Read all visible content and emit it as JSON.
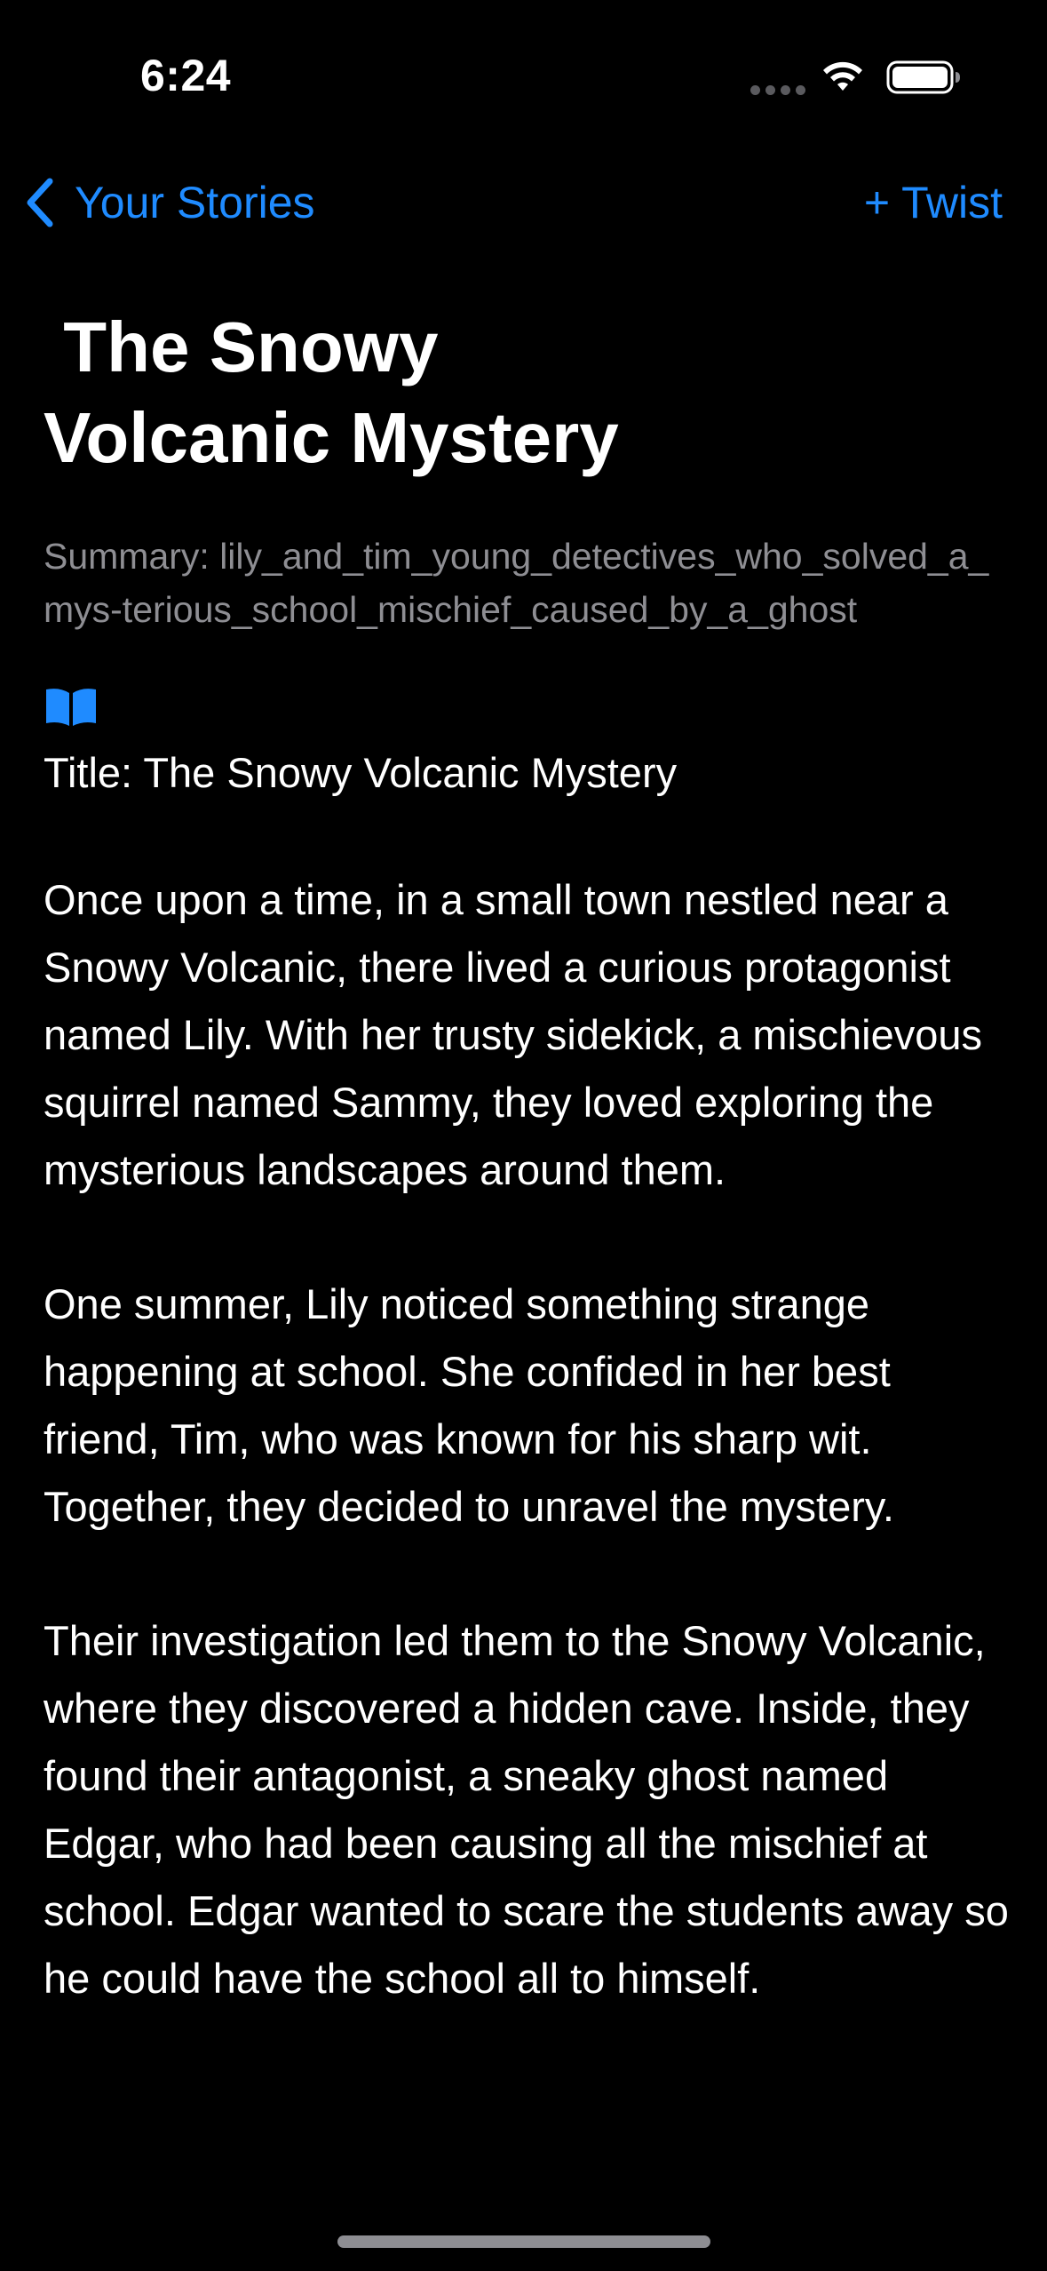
{
  "status_bar": {
    "time": "6:24"
  },
  "nav": {
    "back_label": "Your Stories",
    "twist_label": "+ Twist"
  },
  "story": {
    "heading": " The Snowy\nVolcanic Mystery",
    "summary": "Summary: lily_and_tim_young_detectives_who_solved_a_mys-terious_school_mischief_caused_by_a_ghost",
    "title_line": "Title: The Snowy Volcanic Mystery",
    "paragraphs": [
      "Once upon a time, in a small town nestled near a Snowy Volcanic, there lived a curious protagonist named Lily. With her trusty sidekick, a mischievous squirrel named Sammy, they loved exploring the mysterious landscapes around them.",
      "One summer, Lily noticed something strange happening at school. She confided in her best friend, Tim, who was known for his sharp wit. Together, they decided to unravel the mystery.",
      "Their investigation led them to the Snowy Volcanic, where they discovered a hidden cave. Inside, they found their antagonist, a sneaky ghost named Edgar, who had been causing all the mischief at school. Edgar wanted to scare the students away so he could have the school all to himself."
    ]
  },
  "icons": {
    "back": "chevron-left-icon",
    "book": "book-icon",
    "wifi": "wifi-icon",
    "battery": "battery-icon"
  },
  "colors": {
    "background": "#000000",
    "accent": "#1f8bff",
    "text": "#ffffff",
    "secondary_text": "#8e8e93"
  }
}
